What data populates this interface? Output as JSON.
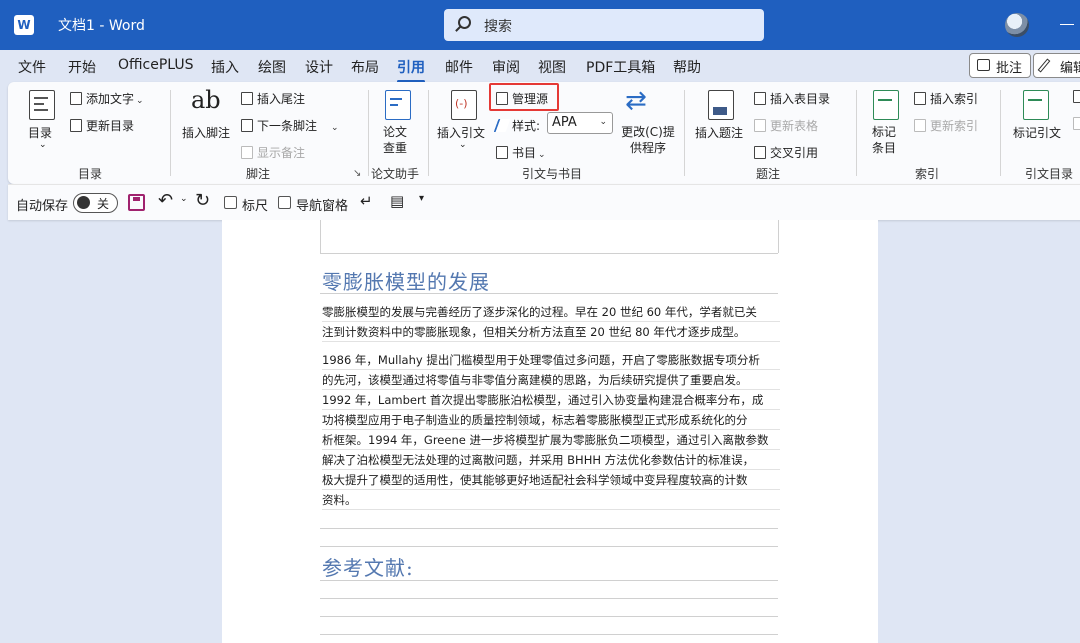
{
  "titlebar": {
    "app_icon": "W",
    "title": "文档1  -  Word",
    "search_placeholder": "搜索",
    "search_icon": "search-icon"
  },
  "tabs": [
    "文件",
    "开始",
    "OfficePLUS",
    "插入",
    "绘图",
    "设计",
    "布局",
    "引用",
    "邮件",
    "审阅",
    "视图",
    "PDF工具箱",
    "帮助"
  ],
  "active_tab": "引用",
  "header_buttons": {
    "comment": "批注",
    "edit": "编辑"
  },
  "ribbon": {
    "toc": {
      "big": "目录",
      "add_text": "添加文字",
      "update": "更新目录",
      "label": "目录"
    },
    "footnotes": {
      "insert_footnote": "插入脚注",
      "insert_endnote": "插入尾注",
      "next_footnote": "下一条脚注",
      "show_notes": "显示备注",
      "label": "脚注",
      "big_glyph": "ab"
    },
    "research": {
      "big": "论文查重",
      "label": "论文助手"
    },
    "citations": {
      "insert_citation": "插入引文",
      "manage_sources": "管理源",
      "style_label": "样式:",
      "style_value": "APA",
      "bibliography": "书目",
      "label": "引文与书目"
    },
    "captions": {
      "update_citation": "更改(C)提供程序",
      "insert_caption": "插入题注",
      "insert_table_of_figures": "插入表目录",
      "update_table": "更新表格",
      "cross_reference": "交叉引用",
      "label": "题注"
    },
    "index": {
      "mark_entry": "标记条目",
      "insert_index": "插入索引",
      "update_index": "更新索引",
      "label": "索引"
    },
    "authorities": {
      "mark_citation": "标记引文",
      "label": "引文目录"
    }
  },
  "qat": {
    "autosave_label": "自动保存",
    "autosave_state": "关",
    "ruler": "标尺",
    "nav_pane": "导航窗格"
  },
  "document": {
    "heading1": "零膨胀模型的发展",
    "para1": [
      "零膨胀模型的发展与完善经历了逐步深化的过程。早在 20 世纪 60 年代，学者就已关",
      "注到计数资料中的零膨胀现象，但相关分析方法直至 20 世纪 80 年代才逐步成型。"
    ],
    "para2": [
      "1986 年，Mullahy 提出门槛模型用于处理零值过多问题，开启了零膨胀数据专项分析",
      "的先河，该模型通过将零值与非零值分离建模的思路，为后续研究提供了重要启发。",
      "1992 年，Lambert 首次提出零膨胀泊松模型，通过引入协变量构建混合概率分布，成",
      "功将模型应用于电子制造业的质量控制领域，标志着零膨胀模型正式形成系统化的分",
      "析框架。1994 年，Greene 进一步将模型扩展为零膨胀负二项模型，通过引入离散参数",
      "解决了泊松模型无法处理的过离散问题，并采用 BHHH 方法优化参数估计的标准误，",
      "极大提升了模型的适用性，使其能够更好地适配社会科学领域中变异程度较高的计数",
      "资料。"
    ],
    "heading2": "参考文献:"
  }
}
